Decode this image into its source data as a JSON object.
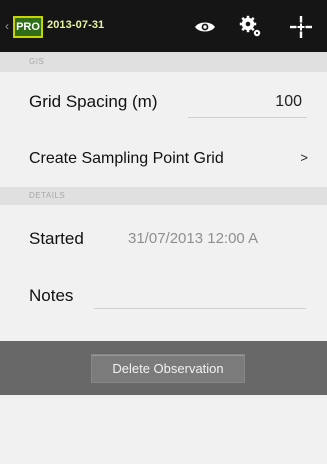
{
  "topbar": {
    "back_chevron": "‹",
    "badge": "PRO",
    "title": "2013-07-31",
    "icons": [
      "eye-icon",
      "settings-icon",
      "crosshair-icon"
    ]
  },
  "sections": {
    "gis": "GIS",
    "details": "DETAILS"
  },
  "gis": {
    "grid_spacing_label": "Grid Spacing (m)",
    "grid_spacing_value": "100",
    "create_grid_label": "Create Sampling Point Grid",
    "create_grid_chevron": ">"
  },
  "details": {
    "started_label": "Started",
    "started_value": "31/07/2013 12:00 A",
    "notes_label": "Notes",
    "notes_value": ""
  },
  "actions": {
    "delete_label": "Delete Observation"
  },
  "colors": {
    "accent": "#c9d300",
    "badge_background": "#2f6d17",
    "topbar": "#151515",
    "action_bar": "#686868"
  }
}
